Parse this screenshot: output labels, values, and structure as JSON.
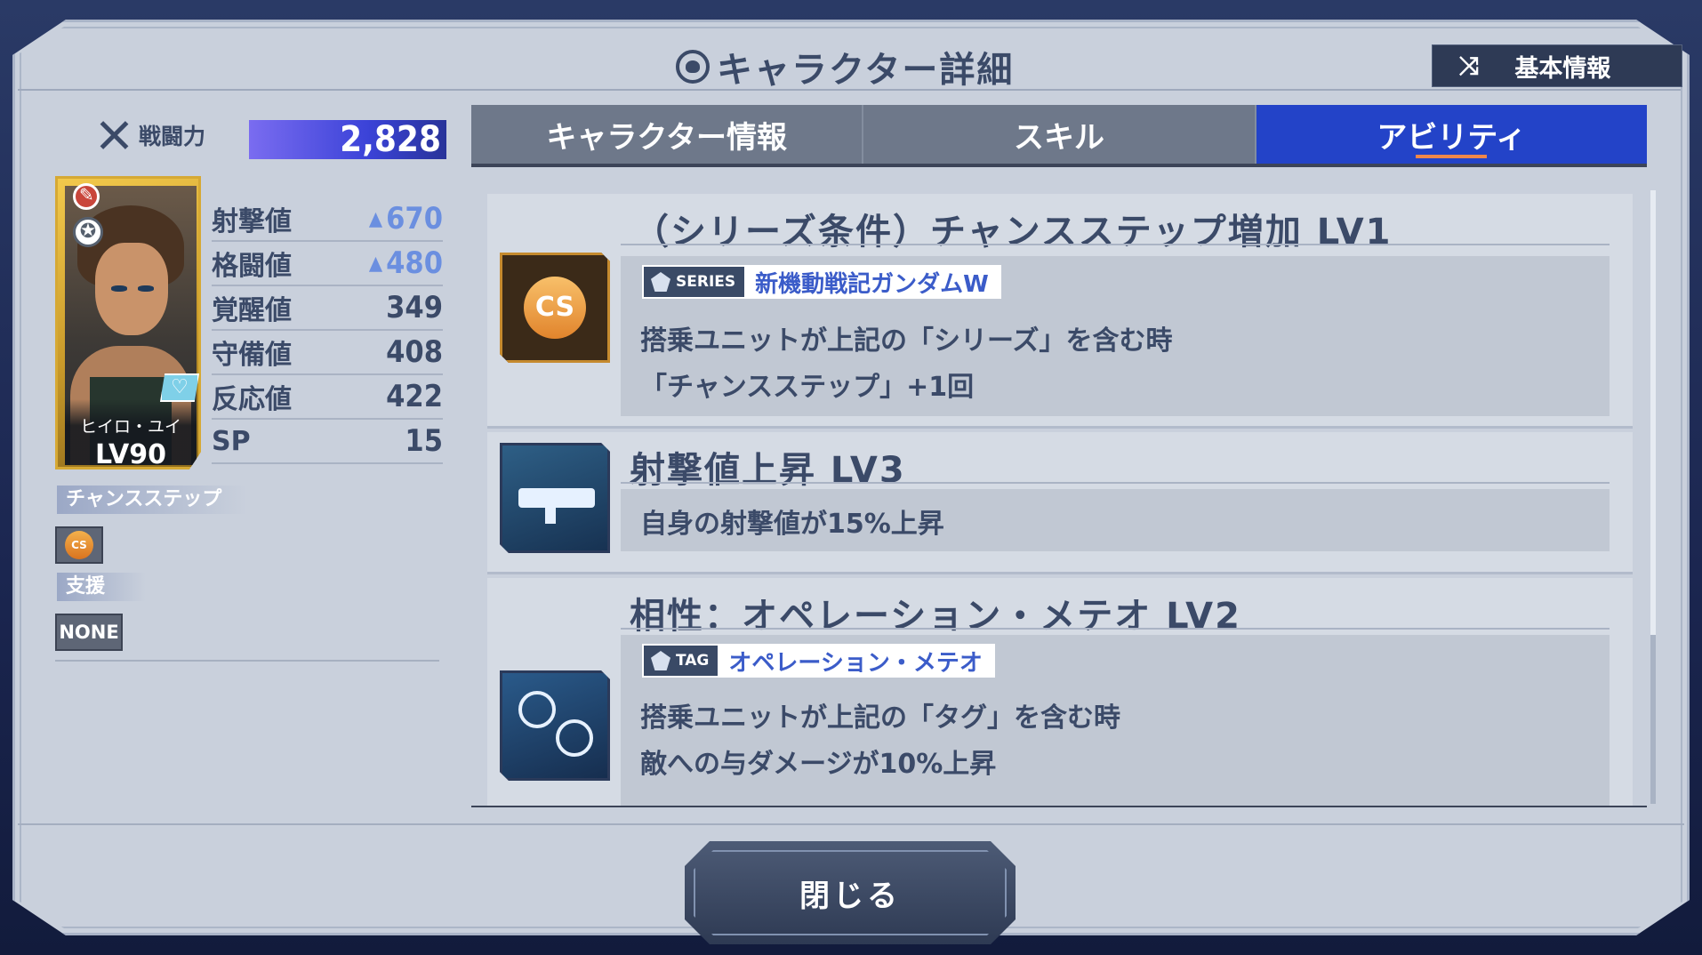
{
  "header": {
    "title": "キャラクター詳細",
    "basic_info_button": "基本情報"
  },
  "character": {
    "power_label": "戦闘力",
    "power_value": "2,828",
    "name": "ヒイロ・ユイ",
    "level": "LV90",
    "stats": [
      {
        "label": "射撃値",
        "value": "670",
        "boosted": true
      },
      {
        "label": "格闘値",
        "value": "480",
        "boosted": true
      },
      {
        "label": "覚醒値",
        "value": "349",
        "boosted": false
      },
      {
        "label": "守備値",
        "value": "408",
        "boosted": false
      },
      {
        "label": "反応値",
        "value": "422",
        "boosted": false
      },
      {
        "label": "SP",
        "value": "15",
        "boosted": false
      }
    ],
    "chance_step_label": "チャンスステップ",
    "chance_step_icon": "CS",
    "support_label": "支援",
    "support_value": "NONE"
  },
  "tabs": [
    {
      "label": "キャラクター情報",
      "active": false
    },
    {
      "label": "スキル",
      "active": false
    },
    {
      "label": "アビリティ",
      "active": true
    }
  ],
  "abilities": [
    {
      "icon": "CS",
      "title": "（シリーズ条件）チャンスステップ増加 LV1",
      "chip_kind": "SERIES",
      "chip_text": "新機動戦記ガンダムW",
      "lines": [
        "搭乗ユニットが上記の「シリーズ」を含む時",
        "「チャンスステップ」+1回"
      ]
    },
    {
      "icon": "gun-icon",
      "title": "射撃値上昇 LV3",
      "lines": [
        "自身の射撃値が15%上昇"
      ]
    },
    {
      "icon": "pilot-tag-icon",
      "title": "相性：オペレーション・メテオ LV2",
      "chip_kind": "TAG",
      "chip_text": "オペレーション・メテオ",
      "lines": [
        "搭乗ユニットが上記の「タグ」を含む時",
        "敵への与ダメージが10%上昇"
      ]
    }
  ],
  "footer": {
    "close_label": "閉じる"
  },
  "colors": {
    "accent_tab": "#2343c8",
    "power_bar": "#3b43d8",
    "text_main": "#3b4a68",
    "chip_text": "#3b5cc9",
    "boost": "#6b8fe0"
  }
}
